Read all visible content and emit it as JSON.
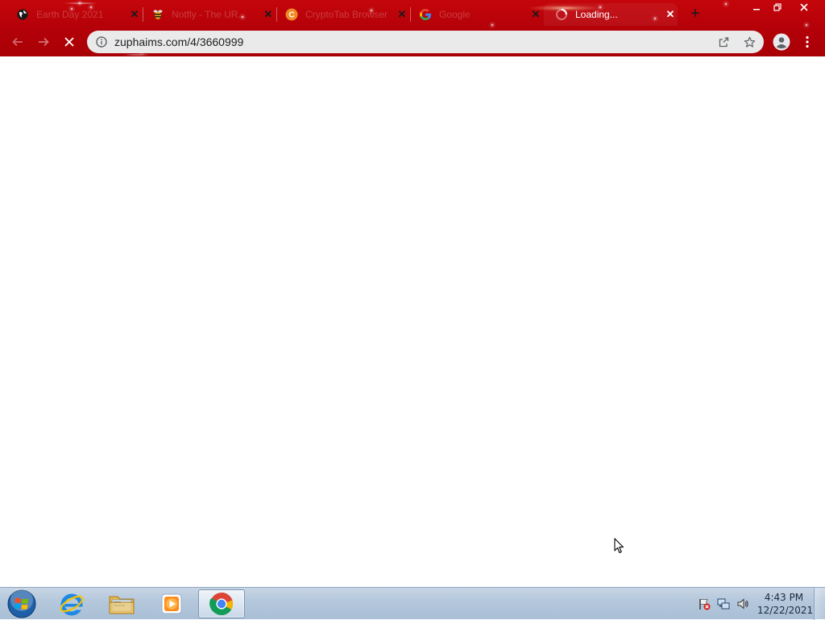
{
  "browser": {
    "tabs": [
      {
        "title": "Earth Day 2021",
        "favicon": "globe-icon",
        "active": false
      },
      {
        "title": "Notfly - The UR...",
        "favicon": "bee-icon",
        "active": false
      },
      {
        "title": "CryptoTab Browser",
        "favicon": "cryptotab-icon",
        "active": false
      },
      {
        "title": "Google",
        "favicon": "google-g-icon",
        "active": false
      },
      {
        "title": "Loading...",
        "favicon": "loading-icon",
        "active": true
      }
    ],
    "new_tab_label": "+",
    "address_bar": {
      "url": "zuphaims.com/4/3660999"
    },
    "theme_colors": {
      "frame": "#b30008",
      "omnibox": "#eaeaea"
    }
  },
  "taskbar": {
    "pinned_apps": [
      "start-orb",
      "internet-explorer",
      "windows-explorer",
      "windows-media-player",
      "google-chrome"
    ],
    "active_app": "google-chrome",
    "clock": {
      "time": "4:43 PM",
      "date": "12/22/2021"
    }
  }
}
